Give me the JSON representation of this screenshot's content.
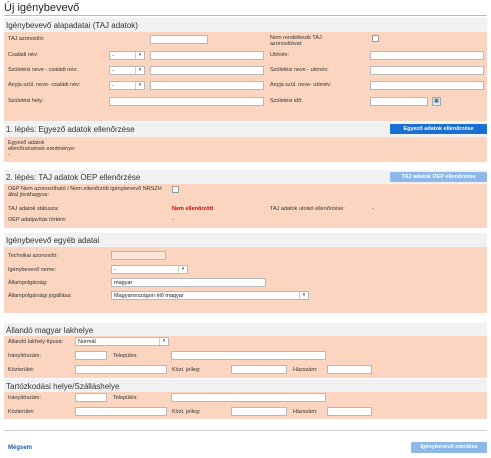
{
  "page": {
    "title": "Új igénybevevő"
  },
  "basic": {
    "title": "Igénybevevő alapadatai (TAJ adatok)",
    "taj_label": "TAJ azonosító:",
    "no_taj_label": "Nem rendelkezik TAJ azonosítóval:",
    "surname_label": "Családi név:",
    "firstname_label": "Utónév:",
    "birth_surname_label": "Születési neve - családi név:",
    "birth_firstname_label": "Születési neve - utónév:",
    "mother_surname_label": "Anyja szül. neve- családi név:",
    "mother_firstname_label": "Anyja szül. neve- utónév:",
    "birthplace_label": "Születési hely:",
    "birthdate_label": "Születési idő:",
    "select_placeholder": "-"
  },
  "step1": {
    "title": "1. lépés: Egyező adatok ellenőrzése",
    "button": "Egyező adatok ellenőrzése",
    "result_label": "Egyező adatok ellenőrzésének eredménye:",
    "result_value": "-"
  },
  "step2": {
    "title": "2. lépés: TAJ adatok OEP ellenőrzése",
    "button": "TAJ adatok OEP ellenőrzése",
    "not_verified_label": "OEP Nem azonosítható / Nem ellenőrzött igénybevevő NRSZH által jóváhagyva:",
    "status_label": "TAJ adatok státusza:",
    "status_value": "Nem ellenőrzött",
    "last_check_label": "TAJ adatok utolsó ellenőrzése:",
    "last_check_value": "-",
    "query_label": "OEP adatjavítás történt:",
    "query_value": "-"
  },
  "other": {
    "title": "Igénybevevő egyéb adatai",
    "tech_id_label": "Technikai azonosító:",
    "gender_label": "Igénybevevő neme:",
    "gender_value": "-",
    "citizenship_label": "Állampolgárság:",
    "citizenship_value": "magyar",
    "legal_label": "Állampolgársági jogállása:",
    "legal_value": "Magyarországon élő magyar"
  },
  "address": {
    "title": "Állandó magyar lakhelye",
    "type_label": "Állandó lakhely típusa:",
    "type_value": "Normál",
    "zip_label": "Irányítószám:",
    "city_label": "Település:",
    "street_label": "Közterület:",
    "street_type_label": "Közt. jelleg:",
    "house_label": "Házszám:"
  },
  "stay": {
    "title": "Tartózkodási helye/Szálláshelye",
    "zip_label": "Irányítószám:",
    "city_label": "Település:",
    "street_label": "Közterület:",
    "street_type_label": "Közt. jelleg:",
    "house_label": "Házszám:"
  },
  "footer": {
    "cancel_label": "Mégsem",
    "save_label": "Igénybevevő mentése"
  },
  "colors": {
    "panel": "#fcd5c0",
    "button": "#1a6fd1",
    "button_disabled": "#8db8ea",
    "status_red": "#d40000"
  },
  "icons": {
    "calendar": "calendar-icon",
    "dropdown": "chevron-down-icon"
  }
}
